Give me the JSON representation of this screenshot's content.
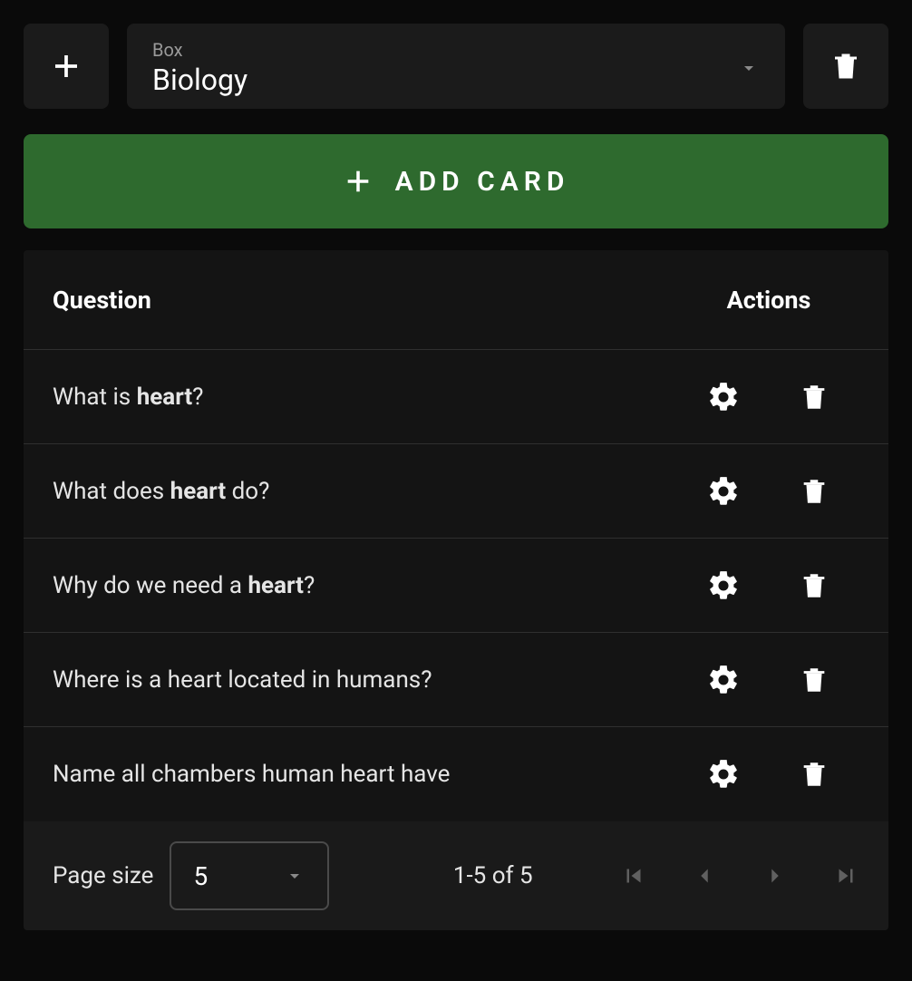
{
  "toolbar": {
    "box_label": "Box",
    "box_value": "Biology",
    "add_card_label": "ADD CARD"
  },
  "table": {
    "header_question": "Question",
    "header_actions": "Actions",
    "rows": [
      {
        "pre": "What is ",
        "bold": "heart",
        "post": "?"
      },
      {
        "pre": "What does ",
        "bold": "heart",
        "post": " do?"
      },
      {
        "pre": "Why do we need a ",
        "bold": "heart",
        "post": "?"
      },
      {
        "pre": "Where is a heart located in humans?",
        "bold": "",
        "post": ""
      },
      {
        "pre": "Name all chambers human heart have",
        "bold": "",
        "post": ""
      }
    ]
  },
  "footer": {
    "page_size_label": "Page size",
    "page_size_value": "5",
    "page_info": "1-5 of 5"
  }
}
